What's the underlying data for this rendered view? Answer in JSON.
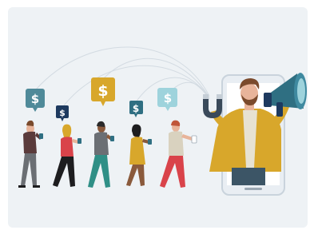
{
  "illustration": {
    "currency_symbol": "$",
    "colors": {
      "background": "#eef2f5",
      "phone_frame": "#e9eef3",
      "phone_outline": "#c9d3dc",
      "teal_dark": "#2f6f82",
      "teal_light": "#9ed3dc",
      "mustard": "#d8a72b",
      "navy": "#1e3a5f",
      "red": "#d9434a",
      "skin_light": "#e8b49a",
      "skin_dark": "#8a5a3c",
      "hair_brown": "#7a4a2c",
      "gray": "#6b6f74",
      "black": "#1d1d1f"
    }
  }
}
